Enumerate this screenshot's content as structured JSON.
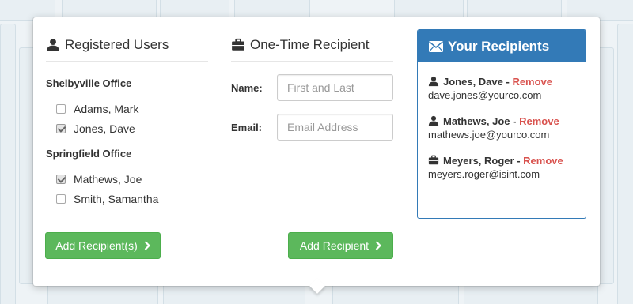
{
  "registered_users": {
    "title": "Registered Users",
    "icon": "user-icon",
    "groups": [
      {
        "label": "Shelbyville Office",
        "users": [
          {
            "name": "Adams, Mark",
            "checked": false
          },
          {
            "name": "Jones, Dave",
            "checked": true
          }
        ]
      },
      {
        "label": "Springfield Office",
        "users": [
          {
            "name": "Mathews, Joe",
            "checked": true
          },
          {
            "name": "Smith, Samantha",
            "checked": false
          }
        ]
      }
    ],
    "add_button_label": "Add Recipient(s)"
  },
  "one_time": {
    "title": "One-Time Recipient",
    "icon": "briefcase-icon",
    "name_label": "Name:",
    "name_placeholder": "First and Last",
    "email_label": "Email:",
    "email_placeholder": "Email Address",
    "add_button_label": "Add Recipient"
  },
  "your_recipients": {
    "title": "Your Recipients",
    "icon": "envelope-icon",
    "remove_label": "Remove",
    "separator": " - ",
    "items": [
      {
        "name": "Jones, Dave",
        "email": "dave.jones@yourco.com",
        "icon": "user-icon"
      },
      {
        "name": "Mathews, Joe",
        "email": "mathews.joe@yourco.com",
        "icon": "user-icon"
      },
      {
        "name": "Meyers, Roger",
        "email": "meyers.roger@isint.com",
        "icon": "briefcase-icon"
      }
    ]
  },
  "colors": {
    "primary": "#337ab7",
    "success": "#5cb85c",
    "danger": "#d9534f"
  }
}
